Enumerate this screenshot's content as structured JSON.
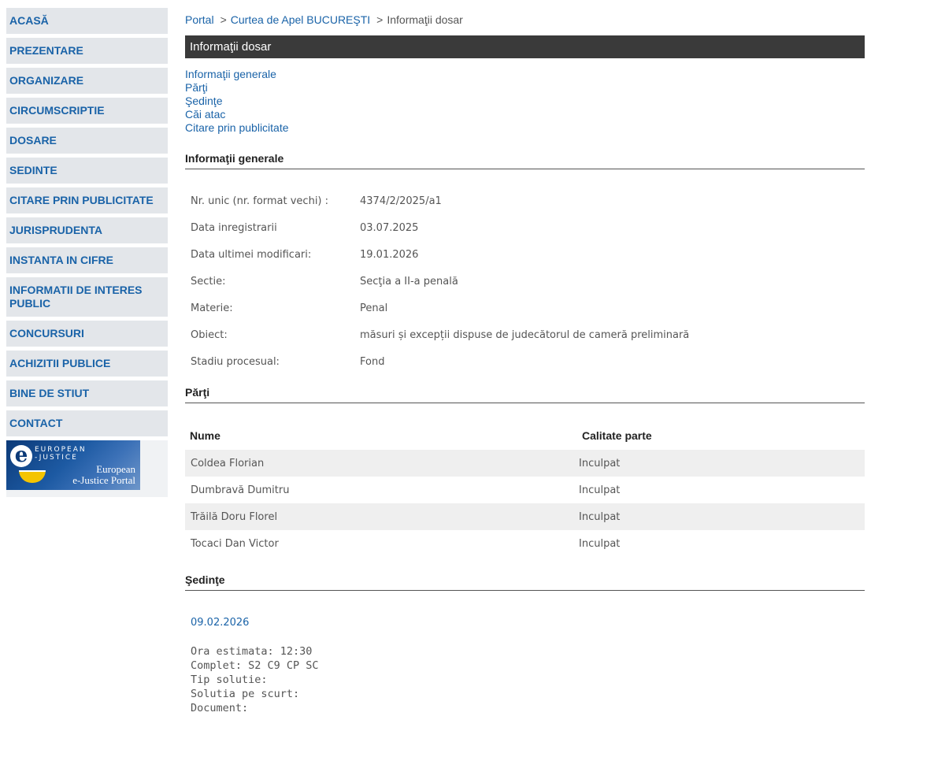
{
  "sidebar": {
    "items": [
      {
        "label": "ACASĂ"
      },
      {
        "label": "PREZENTARE"
      },
      {
        "label": "ORGANIZARE"
      },
      {
        "label": "CIRCUMSCRIPTIE"
      },
      {
        "label": "DOSARE"
      },
      {
        "label": "SEDINTE"
      },
      {
        "label": "CITARE PRIN PUBLICITATE"
      },
      {
        "label": "JURISPRUDENTA"
      },
      {
        "label": "INSTANTA IN CIFRE"
      },
      {
        "label": "INFORMATII DE INTERES PUBLIC"
      },
      {
        "label": "CONCURSURI"
      },
      {
        "label": "ACHIZITII PUBLICE"
      },
      {
        "label": "BINE DE STIUT"
      },
      {
        "label": "CONTACT"
      }
    ],
    "ejustice": {
      "logo_letter": "e",
      "top_text_1": "EUROPEAN",
      "top_text_2": "-JUSTICE",
      "bottom_text_1": "European",
      "bottom_text_2": "e-Justice Portal"
    }
  },
  "breadcrumb": {
    "portal": "Portal",
    "court": "Curtea de Apel BUCUREŞTI",
    "current": "Informaţii dosar",
    "separator": ">"
  },
  "title": "Informaţii dosar",
  "toc": [
    "Informaţii generale",
    "Părţi",
    "Şedinţe",
    "Căi atac",
    "Citare prin publicitate"
  ],
  "general": {
    "heading": "Informaţii generale",
    "rows": [
      {
        "label": "Nr. unic (nr. format vechi) :",
        "value": "4374/2/2025/a1"
      },
      {
        "label": "Data inregistrarii",
        "value": "03.07.2025"
      },
      {
        "label": "Data ultimei modificari:",
        "value": "19.01.2026"
      },
      {
        "label": "Sectie:",
        "value": "Secţia a II-a penală"
      },
      {
        "label": "Materie:",
        "value": "Penal"
      },
      {
        "label": "Obiect:",
        "value": "măsuri și excepții dispuse de judecătorul de cameră preliminară"
      },
      {
        "label": "Stadiu procesual:",
        "value": "Fond"
      }
    ]
  },
  "parti": {
    "heading": "Părţi",
    "col_name": "Nume",
    "col_role": "Calitate parte",
    "rows": [
      {
        "name": "Coldea Florian",
        "role": "Inculpat"
      },
      {
        "name": "Dumbravă Dumitru",
        "role": "Inculpat"
      },
      {
        "name": "Trăilă Doru Florel",
        "role": "Inculpat"
      },
      {
        "name": "Tocaci Dan Victor",
        "role": "Inculpat"
      }
    ]
  },
  "sedinte": {
    "heading": "Şedinţe",
    "date": "09.02.2026",
    "lines": [
      "Ora estimata: 12:30",
      "Complet: S2 C9 CP SC",
      "Tip solutie:",
      "Solutia pe scurt:",
      "Document:"
    ]
  },
  "colors": {
    "link": "#1a63a8",
    "nav_bg": "#e3e6ea",
    "titlebar_bg": "#3a3a3a"
  }
}
